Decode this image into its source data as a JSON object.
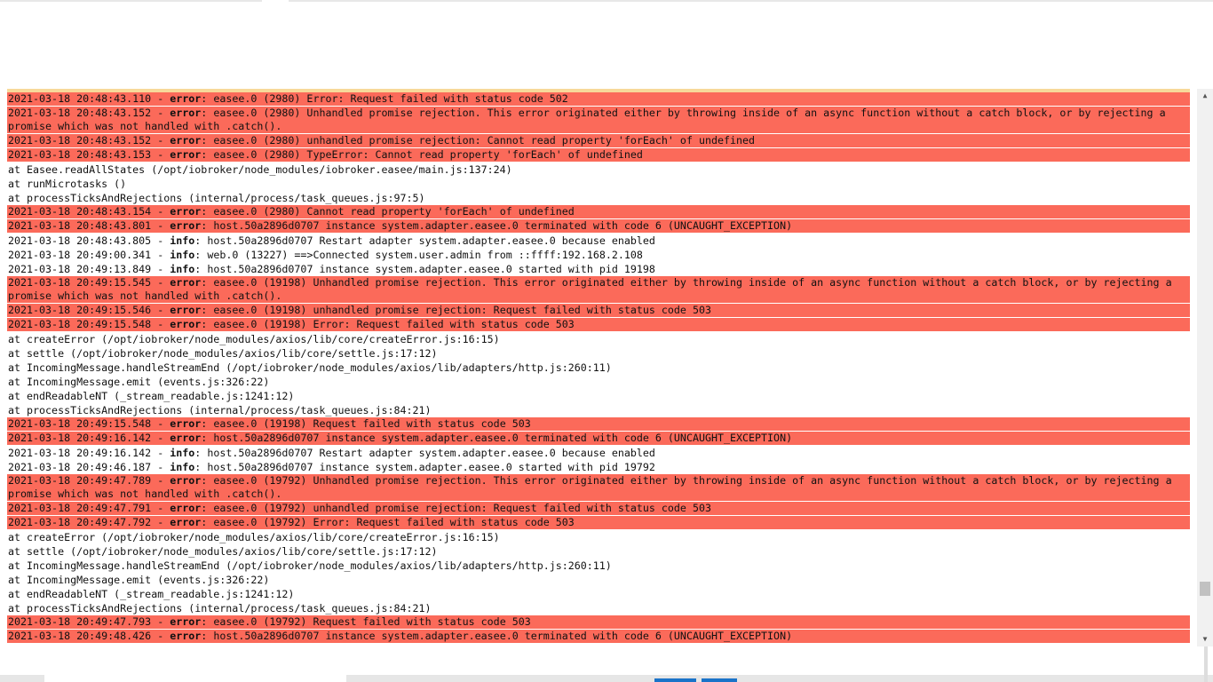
{
  "colors": {
    "error_bg": "#fb6a5a",
    "top_border": "#f7d99a",
    "button": "#1a73c9"
  },
  "log": [
    {
      "type": "error",
      "ts": "2021-03-18 20:48:43.110",
      "level": "error",
      "msg": "easee.0 (2980) Error: Request failed with status code 502"
    },
    {
      "type": "error",
      "ts": "2021-03-18 20:48:43.152",
      "level": "error",
      "msg": "easee.0 (2980) Unhandled promise rejection. This error originated either by throwing inside of an async function without a catch block, or by rejecting a promise which was not handled with .catch()."
    },
    {
      "type": "error",
      "ts": "2021-03-18 20:48:43.152",
      "level": "error",
      "msg": "easee.0 (2980) unhandled promise rejection: Cannot read property 'forEach' of undefined"
    },
    {
      "type": "error",
      "ts": "2021-03-18 20:48:43.153",
      "level": "error",
      "msg": "easee.0 (2980) TypeError: Cannot read property 'forEach' of undefined"
    },
    {
      "type": "trace",
      "text": "at Easee.readAllStates (/opt/iobroker/node_modules/iobroker.easee/main.js:137:24)"
    },
    {
      "type": "trace",
      "text": "at runMicrotasks ()"
    },
    {
      "type": "trace",
      "text": "at processTicksAndRejections (internal/process/task_queues.js:97:5)"
    },
    {
      "type": "error",
      "ts": "2021-03-18 20:48:43.154",
      "level": "error",
      "msg": "easee.0 (2980) Cannot read property 'forEach' of undefined"
    },
    {
      "type": "error",
      "ts": "2021-03-18 20:48:43.801",
      "level": "error",
      "msg": "host.50a2896d0707 instance system.adapter.easee.0 terminated with code 6 (UNCAUGHT_EXCEPTION)"
    },
    {
      "type": "info",
      "ts": "2021-03-18 20:48:43.805",
      "level": "info",
      "msg": "host.50a2896d0707 Restart adapter system.adapter.easee.0 because enabled"
    },
    {
      "type": "info",
      "ts": "2021-03-18 20:49:00.341",
      "level": "info",
      "msg": "web.0 (13227) ==>Connected system.user.admin from ::ffff:192.168.2.108"
    },
    {
      "type": "info",
      "ts": "2021-03-18 20:49:13.849",
      "level": "info",
      "msg": "host.50a2896d0707 instance system.adapter.easee.0 started with pid 19198"
    },
    {
      "type": "error",
      "ts": "2021-03-18 20:49:15.545",
      "level": "error",
      "msg": "easee.0 (19198) Unhandled promise rejection. This error originated either by throwing inside of an async function without a catch block, or by rejecting a promise which was not handled with .catch()."
    },
    {
      "type": "error",
      "ts": "2021-03-18 20:49:15.546",
      "level": "error",
      "msg": "easee.0 (19198) unhandled promise rejection: Request failed with status code 503"
    },
    {
      "type": "error",
      "ts": "2021-03-18 20:49:15.548",
      "level": "error",
      "msg": "easee.0 (19198) Error: Request failed with status code 503"
    },
    {
      "type": "trace",
      "text": "at createError (/opt/iobroker/node_modules/axios/lib/core/createError.js:16:15)"
    },
    {
      "type": "trace",
      "text": "at settle (/opt/iobroker/node_modules/axios/lib/core/settle.js:17:12)"
    },
    {
      "type": "trace",
      "text": "at IncomingMessage.handleStreamEnd (/opt/iobroker/node_modules/axios/lib/adapters/http.js:260:11)"
    },
    {
      "type": "trace",
      "text": "at IncomingMessage.emit (events.js:326:22)"
    },
    {
      "type": "trace",
      "text": "at endReadableNT (_stream_readable.js:1241:12)"
    },
    {
      "type": "trace",
      "text": "at processTicksAndRejections (internal/process/task_queues.js:84:21)"
    },
    {
      "type": "error",
      "ts": "2021-03-18 20:49:15.548",
      "level": "error",
      "msg": "easee.0 (19198) Request failed with status code 503"
    },
    {
      "type": "error",
      "ts": "2021-03-18 20:49:16.142",
      "level": "error",
      "msg": "host.50a2896d0707 instance system.adapter.easee.0 terminated with code 6 (UNCAUGHT_EXCEPTION)"
    },
    {
      "type": "info",
      "ts": "2021-03-18 20:49:16.142",
      "level": "info",
      "msg": "host.50a2896d0707 Restart adapter system.adapter.easee.0 because enabled"
    },
    {
      "type": "info",
      "ts": "2021-03-18 20:49:46.187",
      "level": "info",
      "msg": "host.50a2896d0707 instance system.adapter.easee.0 started with pid 19792"
    },
    {
      "type": "error",
      "ts": "2021-03-18 20:49:47.789",
      "level": "error",
      "msg": "easee.0 (19792) Unhandled promise rejection. This error originated either by throwing inside of an async function without a catch block, or by rejecting a promise which was not handled with .catch()."
    },
    {
      "type": "error",
      "ts": "2021-03-18 20:49:47.791",
      "level": "error",
      "msg": "easee.0 (19792) unhandled promise rejection: Request failed with status code 503"
    },
    {
      "type": "error",
      "ts": "2021-03-18 20:49:47.792",
      "level": "error",
      "msg": "easee.0 (19792) Error: Request failed with status code 503"
    },
    {
      "type": "trace",
      "text": "at createError (/opt/iobroker/node_modules/axios/lib/core/createError.js:16:15)"
    },
    {
      "type": "trace",
      "text": "at settle (/opt/iobroker/node_modules/axios/lib/core/settle.js:17:12)"
    },
    {
      "type": "trace",
      "text": "at IncomingMessage.handleStreamEnd (/opt/iobroker/node_modules/axios/lib/adapters/http.js:260:11)"
    },
    {
      "type": "trace",
      "text": "at IncomingMessage.emit (events.js:326:22)"
    },
    {
      "type": "trace",
      "text": "at endReadableNT (_stream_readable.js:1241:12)"
    },
    {
      "type": "trace",
      "text": "at processTicksAndRejections (internal/process/task_queues.js:84:21)"
    },
    {
      "type": "error",
      "ts": "2021-03-18 20:49:47.793",
      "level": "error",
      "msg": "easee.0 (19792) Request failed with status code 503"
    },
    {
      "type": "error",
      "ts": "2021-03-18 20:49:48.426",
      "level": "error",
      "msg": "host.50a2896d0707 instance system.adapter.easee.0 terminated with code 6 (UNCAUGHT_EXCEPTION)"
    }
  ],
  "scrollbar": {
    "position_percent": 93
  }
}
